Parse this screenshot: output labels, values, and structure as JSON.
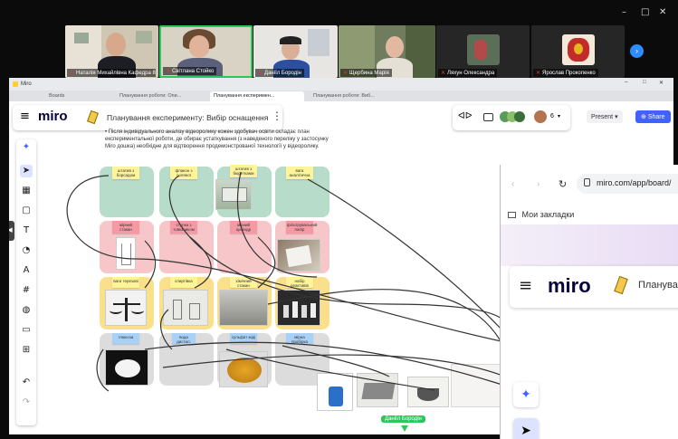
{
  "zoom": {
    "window_controls": [
      "–",
      "□",
      "✕"
    ],
    "participants": [
      {
        "name": "Наталія Михайлівна Кафедра 8"
      },
      {
        "name": "Світлана Стойко"
      },
      {
        "name": "Даніїл Бородін"
      },
      {
        "name": "Щербина Марія"
      },
      {
        "name": "Ляхун Олександра"
      },
      {
        "name": "Ярослав Прокопенко"
      }
    ],
    "next_label": "›"
  },
  "browser": {
    "app_name": "Miro",
    "tabs": [
      "Boards",
      "Планування роботи: Опи...",
      "Планування експеримен...",
      "Планування роботи: Виб..."
    ],
    "active_tab_index": 2,
    "controls": [
      "–",
      "□",
      "✕"
    ]
  },
  "miro": {
    "logo": "miro",
    "board_title": "Планування експерименту: Вибір оснащення",
    "menu_icon": "⋮",
    "collaborators_count": "6",
    "present_label": "Present",
    "share_label": "Share",
    "accent": "#4262ff"
  },
  "board": {
    "instructions": "• Після індивідуального аналізу відеоролику кожен здобувач освіти складає план експериментальної роботи, де обирає устаткування (з наведеного переліку у застосунку Miro дошка) необхідне для відтворення продемонстрованої технології у відеоролику.",
    "stickies": [
      {
        "text": "штатив з борсадом"
      },
      {
        "text": "флакон з соляної"
      },
      {
        "text": "штатив з бюретками"
      },
      {
        "text": "вага аналітична"
      },
      {
        "text": "мірний стакан"
      },
      {
        "text": "ступка з товкачиком"
      },
      {
        "text": "мірний циліндр"
      },
      {
        "text": "фільтрувальний папір"
      },
      {
        "text": "ваги терезові"
      },
      {
        "text": "спиртівка"
      },
      {
        "text": "хімічний стакан"
      },
      {
        "text": "набір реактивів"
      },
      {
        "text": "глюкоза"
      },
      {
        "text": "вода дистил."
      },
      {
        "text": "сульфат міді"
      },
      {
        "text": "мірна пробірка"
      }
    ],
    "cursor_user": "Даніїл Бородін"
  },
  "browser2": {
    "url": "miro.com/app/board/",
    "bookmarks_label": "Мои закладки",
    "logo": "miro",
    "title_fragment": "Плануван"
  }
}
